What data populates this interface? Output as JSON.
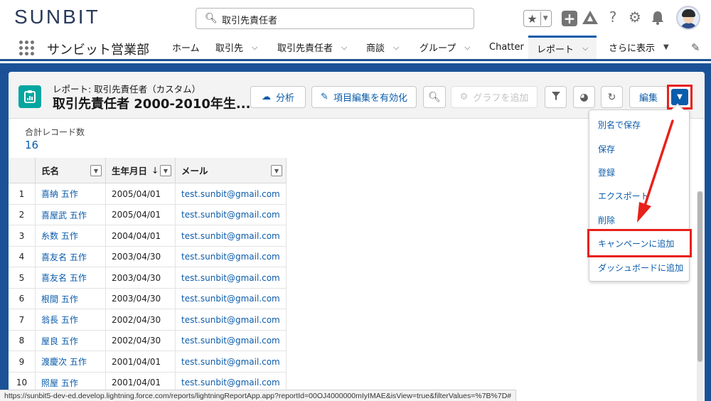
{
  "header": {
    "logo": "SUNBIT",
    "search_value": "取引先責任者",
    "search_icon": "search-icon",
    "icons": [
      "star-icon",
      "plus-icon",
      "trailhead-icon",
      "help-icon",
      "gear-icon",
      "bell-icon",
      "avatar"
    ]
  },
  "nav": {
    "app_name": "サンビット営業部",
    "items": [
      {
        "label": "ホーム",
        "dropdown": false
      },
      {
        "label": "取引先",
        "dropdown": true
      },
      {
        "label": "取引先責任者",
        "dropdown": true
      },
      {
        "label": "商談",
        "dropdown": true
      },
      {
        "label": "グループ",
        "dropdown": true
      },
      {
        "label": "Chatter",
        "dropdown": false
      },
      {
        "label": "レポート",
        "dropdown": true,
        "active": true
      },
      {
        "label": "さらに表示",
        "dropdown": true
      }
    ],
    "chevron": "⌵",
    "more_caret": "▼"
  },
  "report": {
    "subtitle": "レポート: 取引先責任者（カスタム）",
    "title": "取引先責任者 2000-2010年生...",
    "buttons": {
      "analysis": "分析",
      "enable_edit": "項目編集を有効化",
      "add_chart": "グラフを追加",
      "edit": "編集"
    },
    "record_count_label": "合計レコード数",
    "record_count": "16"
  },
  "table": {
    "headers": {
      "name": "氏名",
      "birthdate": "生年月日",
      "sort_arrow": "↓",
      "email": "メール"
    },
    "rows": [
      {
        "num": "1",
        "name": "喜納 五作",
        "birthdate": "2005/04/01",
        "email": "test.sunbit@gmail.com"
      },
      {
        "num": "2",
        "name": "喜屋武 五作",
        "birthdate": "2005/04/01",
        "email": "test.sunbit@gmail.com"
      },
      {
        "num": "3",
        "name": "糸数 五作",
        "birthdate": "2004/04/01",
        "email": "test.sunbit@gmail.com"
      },
      {
        "num": "4",
        "name": "喜友名 五作",
        "birthdate": "2003/04/30",
        "email": "test.sunbit@gmail.com"
      },
      {
        "num": "5",
        "name": "喜友名 五作",
        "birthdate": "2003/04/30",
        "email": "test.sunbit@gmail.com"
      },
      {
        "num": "6",
        "name": "根間 五作",
        "birthdate": "2003/04/30",
        "email": "test.sunbit@gmail.com"
      },
      {
        "num": "7",
        "name": "翁長 五作",
        "birthdate": "2002/04/30",
        "email": "test.sunbit@gmail.com"
      },
      {
        "num": "8",
        "name": "屋良 五作",
        "birthdate": "2002/04/30",
        "email": "test.sunbit@gmail.com"
      },
      {
        "num": "9",
        "name": "渡慶次 五作",
        "birthdate": "2001/04/01",
        "email": "test.sunbit@gmail.com"
      },
      {
        "num": "10",
        "name": "照屋 五作",
        "birthdate": "2001/04/01",
        "email": "test.sunbit@gmail.com"
      }
    ]
  },
  "menu": {
    "items": [
      {
        "label": "別名で保存"
      },
      {
        "label": "保存"
      },
      {
        "label": "登録"
      },
      {
        "label": "エクスポート"
      },
      {
        "label": "削除"
      },
      {
        "label": "キャンペーンに追加",
        "highlighted": true
      },
      {
        "label": "ダッシュボードに追加"
      }
    ]
  },
  "status_url": "https://sunbit5-dev-ed.develop.lightning.force.com/reports/lightningReportApp.app?reportId=00OJ4000000mIyIMAE&isView=true&filterValues=%7B%7D#",
  "colors": {
    "brand_blue": "#1b5297",
    "link": "#0b5cab",
    "annotation_red": "#e8211a",
    "report_icon": "#05a6a0"
  }
}
